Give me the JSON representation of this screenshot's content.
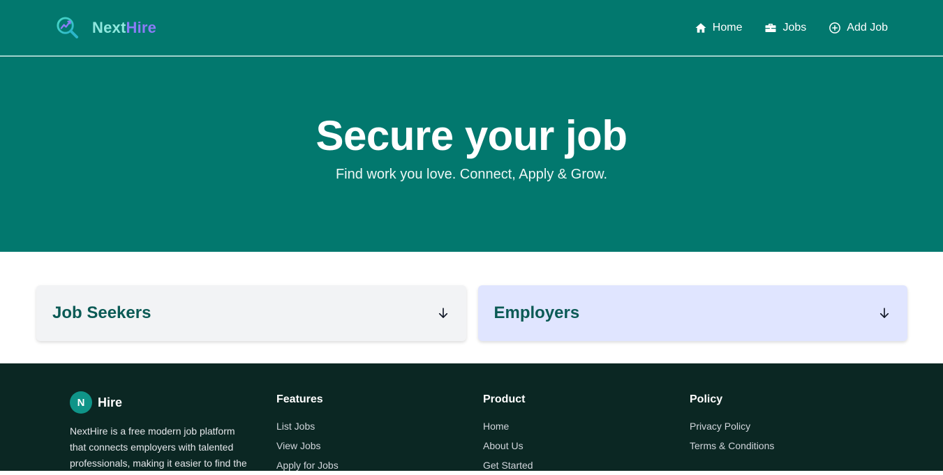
{
  "nav": {
    "brand": {
      "part1": "Next",
      "part2": "Hire",
      "logo_icon": "magnifier-chart-icon"
    },
    "links": [
      {
        "label": "Home",
        "icon": "home-icon"
      },
      {
        "label": "Jobs",
        "icon": "briefcase-icon"
      },
      {
        "label": "Add Job",
        "icon": "plus-circle-icon"
      }
    ]
  },
  "hero": {
    "title": "Secure your job",
    "subtitle": "Find work you love. Connect, Apply & Grow."
  },
  "cards": [
    {
      "title": "Job Seekers",
      "icon": "arrow-down-icon"
    },
    {
      "title": "Employers",
      "icon": "arrow-down-icon"
    }
  ],
  "footer": {
    "brand": {
      "badge": "N",
      "name": "Hire",
      "description": "NextHire is a free modern job platform that connects employers with talented professionals, making it easier to find the"
    },
    "columns": [
      {
        "heading": "Features",
        "items": [
          "List Jobs",
          "View Jobs",
          "Apply for Jobs"
        ]
      },
      {
        "heading": "Product",
        "items": [
          "Home",
          "About Us",
          "Get Started"
        ]
      },
      {
        "heading": "Policy",
        "items": [
          "Privacy Policy",
          "Terms & Conditions"
        ]
      }
    ]
  },
  "colors": {
    "primary": "#02786e",
    "footer_bg": "#0b2723",
    "card_seekers_bg": "#f2f3f5",
    "card_employers_bg": "#e0e5ff",
    "card_title": "#0b5a55"
  }
}
